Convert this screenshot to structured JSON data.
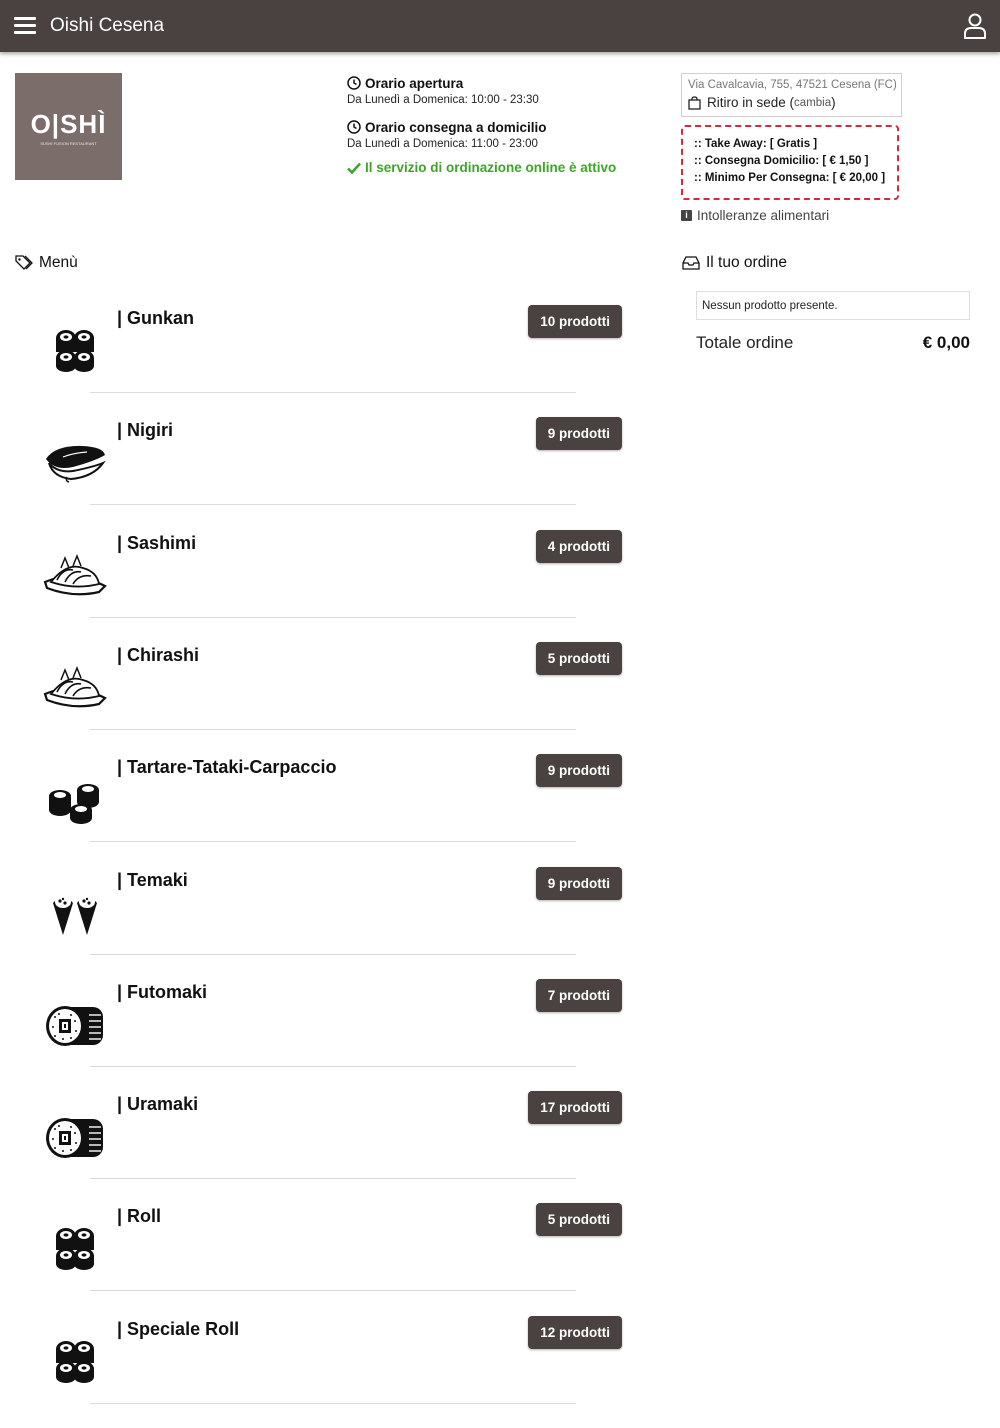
{
  "header": {
    "title": "Oishi Cesena",
    "menu_icon": "hamburger-icon",
    "user_icon": "user-icon",
    "bar_color": "#4a4240"
  },
  "logo": {
    "text": "O|SHÌ",
    "subtitle": "SUSHI FUSION RESTAURANT",
    "bg_color": "#7b6e6a"
  },
  "hours": {
    "opening_title": "Orario apertura",
    "opening_text": "Da Lunedì a Domenica: 10:00 - 23:30",
    "delivery_title": "Orario consegna a domicilio",
    "delivery_text": "Da Lunedì a Domenica: 11:00 - 23:00",
    "online_status": "Il servizio di ordinazione online è attivo",
    "online_color": "#3fa52a"
  },
  "address": {
    "line": "Via Cavalcavia, 755, 47521 Cesena (FC)",
    "mode": "Ritiro in sede",
    "change_label": "cambia"
  },
  "fees": [
    ":: Take Away: [ Gratis ]",
    ":: Consegna Domicilio: [ € 1,50 ]",
    ":: Minimo Per Consegna: [ € 20,00 ]"
  ],
  "fees_border_color": "#d62a3a",
  "intolerances_label": "Intolleranze alimentari",
  "menu": {
    "title": "Menù",
    "categories": [
      {
        "name": "| Gunkan",
        "count": "10 prodotti",
        "icon": "sushi-rolls-icon"
      },
      {
        "name": "| Nigiri",
        "count": "9 prodotti",
        "icon": "nigiri-icon"
      },
      {
        "name": "| Sashimi",
        "count": "4 prodotti",
        "icon": "sashimi-plate-icon"
      },
      {
        "name": "| Chirashi",
        "count": "5 prodotti",
        "icon": "sashimi-plate-icon"
      },
      {
        "name": "| Tartare-Tataki-Carpaccio",
        "count": "9 prodotti",
        "icon": "roll-stack-icon"
      },
      {
        "name": "| Temaki",
        "count": "9 prodotti",
        "icon": "temaki-cone-icon"
      },
      {
        "name": "| Futomaki",
        "count": "7 prodotti",
        "icon": "futomaki-icon"
      },
      {
        "name": "| Uramaki",
        "count": "17 prodotti",
        "icon": "futomaki-icon"
      },
      {
        "name": "| Roll",
        "count": "5 prodotti",
        "icon": "sushi-rolls-icon"
      },
      {
        "name": "| Speciale Roll",
        "count": "12 prodotti",
        "icon": "sushi-rolls-icon"
      }
    ]
  },
  "order": {
    "title": "Il tuo ordine",
    "empty_text": "Nessun prodotto presente.",
    "total_label": "Totale ordine",
    "total_value": "€ 0,00"
  }
}
